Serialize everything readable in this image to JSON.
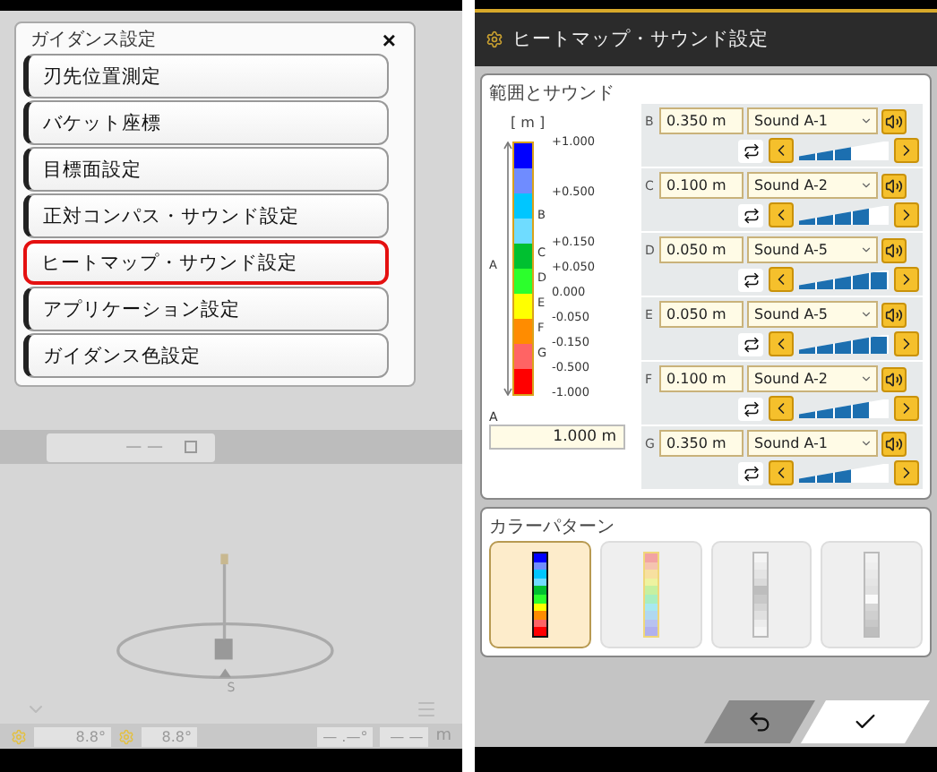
{
  "left_screen": {
    "menu": {
      "title": "ガイダンス設定",
      "close": "×",
      "items": [
        {
          "label": "刃先位置測定",
          "selected": false
        },
        {
          "label": "バケット座標",
          "selected": false
        },
        {
          "label": "目標面設定",
          "selected": false
        },
        {
          "label": "正対コンパス・サウンド設定",
          "selected": false
        },
        {
          "label": "ヒートマップ・サウンド設定",
          "selected": true
        },
        {
          "label": "アプリケーション設定",
          "selected": false
        },
        {
          "label": "ガイダンス色設定",
          "selected": false
        }
      ]
    },
    "readout": {
      "value": "— —"
    },
    "compass": {
      "label": "S"
    },
    "status_bar": {
      "angle_1": "8.8°",
      "angle_2": "8.8°",
      "value_3": "— .—°",
      "value_4": "— —",
      "unit": "m"
    }
  },
  "right_screen": {
    "title": "ヒートマップ・サウンド設定",
    "range_section": {
      "title": "範囲とサウンド",
      "unit": "[ m ]",
      "scale_labels": [
        "+1.000",
        "+0.500",
        "+0.150",
        "+0.050",
        "0.000",
        "-0.050",
        "-0.150",
        "-0.500",
        "-1.000"
      ],
      "scale_letters": [
        "A",
        "B",
        "C",
        "D",
        "E",
        "F",
        "G"
      ],
      "range_a": {
        "label": "A",
        "value": "1.000 m"
      },
      "rows": [
        {
          "letter": "B",
          "value": "0.350 m",
          "sound": "Sound A-1",
          "level": 0.6
        },
        {
          "letter": "C",
          "value": "0.100 m",
          "sound": "Sound A-2",
          "level": 0.8
        },
        {
          "letter": "D",
          "value": "0.050 m",
          "sound": "Sound A-5",
          "level": 1
        },
        {
          "letter": "E",
          "value": "0.050 m",
          "sound": "Sound A-5",
          "level": 1
        },
        {
          "letter": "F",
          "value": "0.100 m",
          "sound": "Sound A-2",
          "level": 0.8
        },
        {
          "letter": "G",
          "value": "0.350 m",
          "sound": "Sound A-1",
          "level": 0.6
        }
      ]
    },
    "color_pattern": {
      "title": "カラーパターン",
      "options": [
        {
          "kind": "rainbow",
          "selected": true
        },
        {
          "kind": "pastel",
          "selected": false
        },
        {
          "kind": "gray_mid",
          "selected": false
        },
        {
          "kind": "gray_light",
          "selected": false
        }
      ]
    }
  }
}
